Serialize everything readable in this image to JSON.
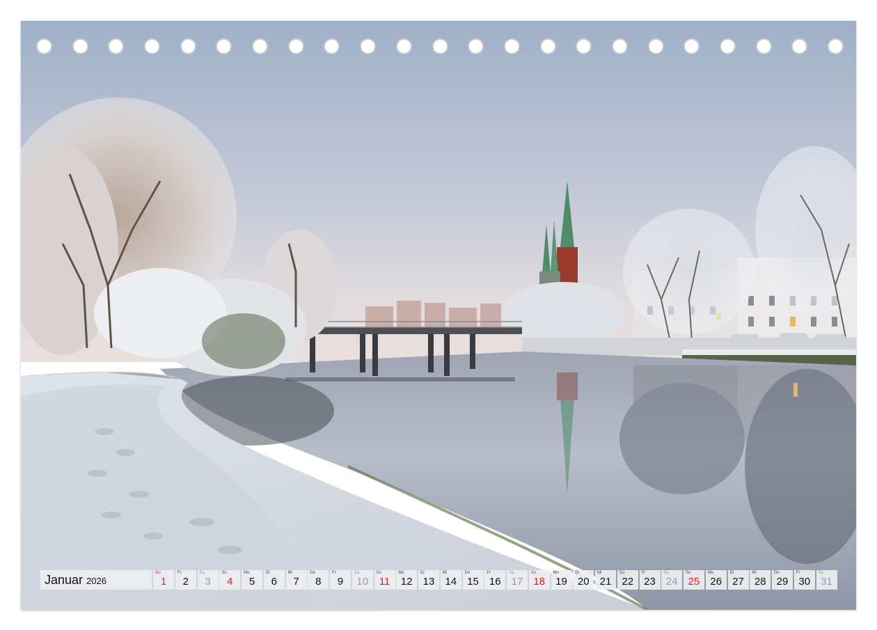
{
  "calendar": {
    "month": "Januar",
    "year": "2026",
    "days": [
      {
        "wd": "Do",
        "d": "1",
        "type": "hol"
      },
      {
        "wd": "Fr",
        "d": "2",
        "type": "wk"
      },
      {
        "wd": "Sa",
        "d": "3",
        "type": "sat"
      },
      {
        "wd": "So",
        "d": "4",
        "type": "sun"
      },
      {
        "wd": "Mo",
        "d": "5",
        "type": "wk"
      },
      {
        "wd": "Di",
        "d": "6",
        "type": "wk"
      },
      {
        "wd": "Mi",
        "d": "7",
        "type": "wk"
      },
      {
        "wd": "Do",
        "d": "8",
        "type": "wk"
      },
      {
        "wd": "Fr",
        "d": "9",
        "type": "wk"
      },
      {
        "wd": "Sa",
        "d": "10",
        "type": "sat"
      },
      {
        "wd": "So",
        "d": "11",
        "type": "sun"
      },
      {
        "wd": "Mo",
        "d": "12",
        "type": "wk"
      },
      {
        "wd": "Di",
        "d": "13",
        "type": "wk"
      },
      {
        "wd": "Mi",
        "d": "14",
        "type": "wk"
      },
      {
        "wd": "Do",
        "d": "15",
        "type": "wk"
      },
      {
        "wd": "Fr",
        "d": "16",
        "type": "wk"
      },
      {
        "wd": "Sa",
        "d": "17",
        "type": "sat"
      },
      {
        "wd": "So",
        "d": "18",
        "type": "sun"
      },
      {
        "wd": "Mo",
        "d": "19",
        "type": "wk"
      },
      {
        "wd": "Di",
        "d": "20",
        "type": "wk"
      },
      {
        "wd": "Mi",
        "d": "21",
        "type": "wk"
      },
      {
        "wd": "Do",
        "d": "22",
        "type": "wk"
      },
      {
        "wd": "Fr",
        "d": "23",
        "type": "wk"
      },
      {
        "wd": "Sa",
        "d": "24",
        "type": "sat"
      },
      {
        "wd": "So",
        "d": "25",
        "type": "sun"
      },
      {
        "wd": "Mo",
        "d": "26",
        "type": "wk"
      },
      {
        "wd": "Di",
        "d": "27",
        "type": "wk"
      },
      {
        "wd": "Mi",
        "d": "28",
        "type": "wk"
      },
      {
        "wd": "Do",
        "d": "29",
        "type": "wk"
      },
      {
        "wd": "Fr",
        "d": "30",
        "type": "wk"
      },
      {
        "wd": "Sa",
        "d": "31",
        "type": "sat"
      }
    ]
  },
  "binding": {
    "hole_count": 23
  },
  "colors": {
    "sunday_red": "#e0201c",
    "saturday_grey": "#9a9a9a",
    "sky_top": "#9fb0c6",
    "sky_bottom": "#e6dede",
    "church_green": "#4e8c6a",
    "brick": "#9a3a2c"
  }
}
